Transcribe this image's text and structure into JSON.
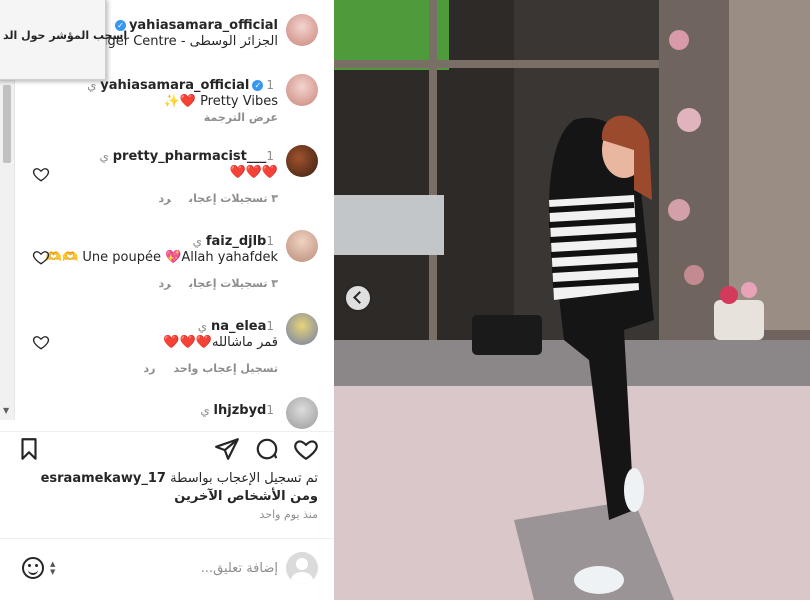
{
  "tooltip": {
    "text": "اسحب المؤشر حول الد"
  },
  "comments": [
    {
      "user": "yahiasamara_official",
      "time": "",
      "body": "الجزائر الوسطى - Alger Centre",
      "verified": true
    },
    {
      "user": "yahiasamara_official",
      "time": "1 ي",
      "body": "Pretty Vibes ❤️✨",
      "translate": "عرض الترجمة",
      "verified": true
    },
    {
      "user": "pretty_pharmacist___",
      "time": "1 ي",
      "body": "❤️❤️❤️",
      "likes": "٣ تسجيلات إعجاب",
      "reply": "رد"
    },
    {
      "user": "faiz_djlb",
      "time": "1 ي",
      "body": "Une poupée 💖Allah yahafdek 🫶🫶",
      "likes": "٣ تسجيلات إعجاب",
      "reply": "رد"
    },
    {
      "user": "na_elea",
      "time": "1 ي",
      "body": "قمر ماشالله❤️❤️❤️",
      "likes": "تسجيل إعجاب واحد",
      "reply": "رد"
    },
    {
      "user": "lhjzbyd",
      "time": "1 ي",
      "body": ""
    }
  ],
  "likes": {
    "line1": "تم تسجيل الإعجاب بواسطة",
    "user": "esraamekawy_17",
    "line2": "ومن الأشخاص الآخرين"
  },
  "posted_ago": "منذ يوم واحد",
  "add_comment": {
    "placeholder": "إضافة تعليق..."
  },
  "colors": {
    "verified": "#3897f0",
    "muted": "#8e8e8e"
  }
}
